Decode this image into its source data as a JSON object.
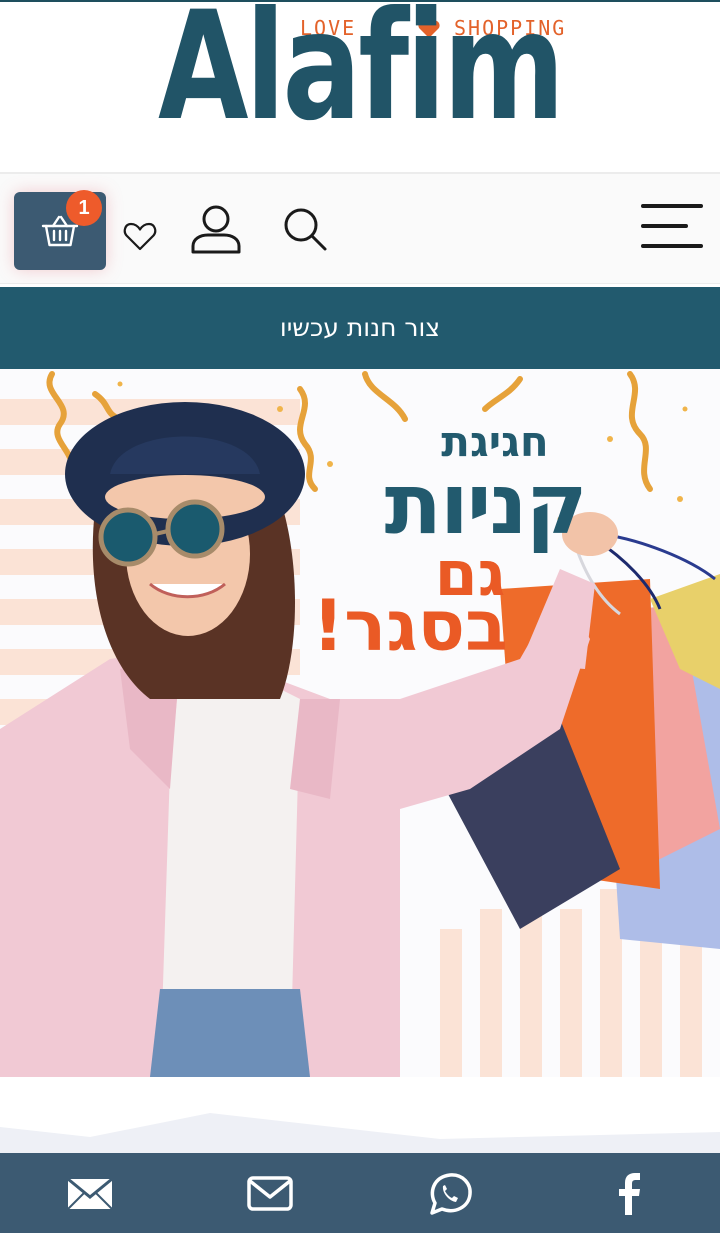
{
  "logo": {
    "love": "LOVE",
    "shopping": "SHOPPING",
    "brand": "Alafim"
  },
  "header": {
    "cart_count": "1"
  },
  "cta": {
    "label": "צור חנות עכשיו"
  },
  "banner": {
    "line1": "חגיגת",
    "line2": "קניות",
    "line3": "גם",
    "line4": "בסגר!"
  },
  "colors": {
    "brand_teal": "#215467",
    "accent_orange": "#e3622a",
    "cart_bg": "#3c5a72",
    "badge": "#ee5b2b",
    "cta_bg": "#225a6e",
    "footer_bg": "#3c5a72"
  },
  "icons": {
    "cart": "basket-icon",
    "wishlist": "heart-icon",
    "account": "user-icon",
    "search": "search-icon",
    "menu": "hamburger-menu-icon",
    "footer": [
      "mail-icon",
      "envelope-icon",
      "whatsapp-icon",
      "facebook-icon"
    ]
  }
}
